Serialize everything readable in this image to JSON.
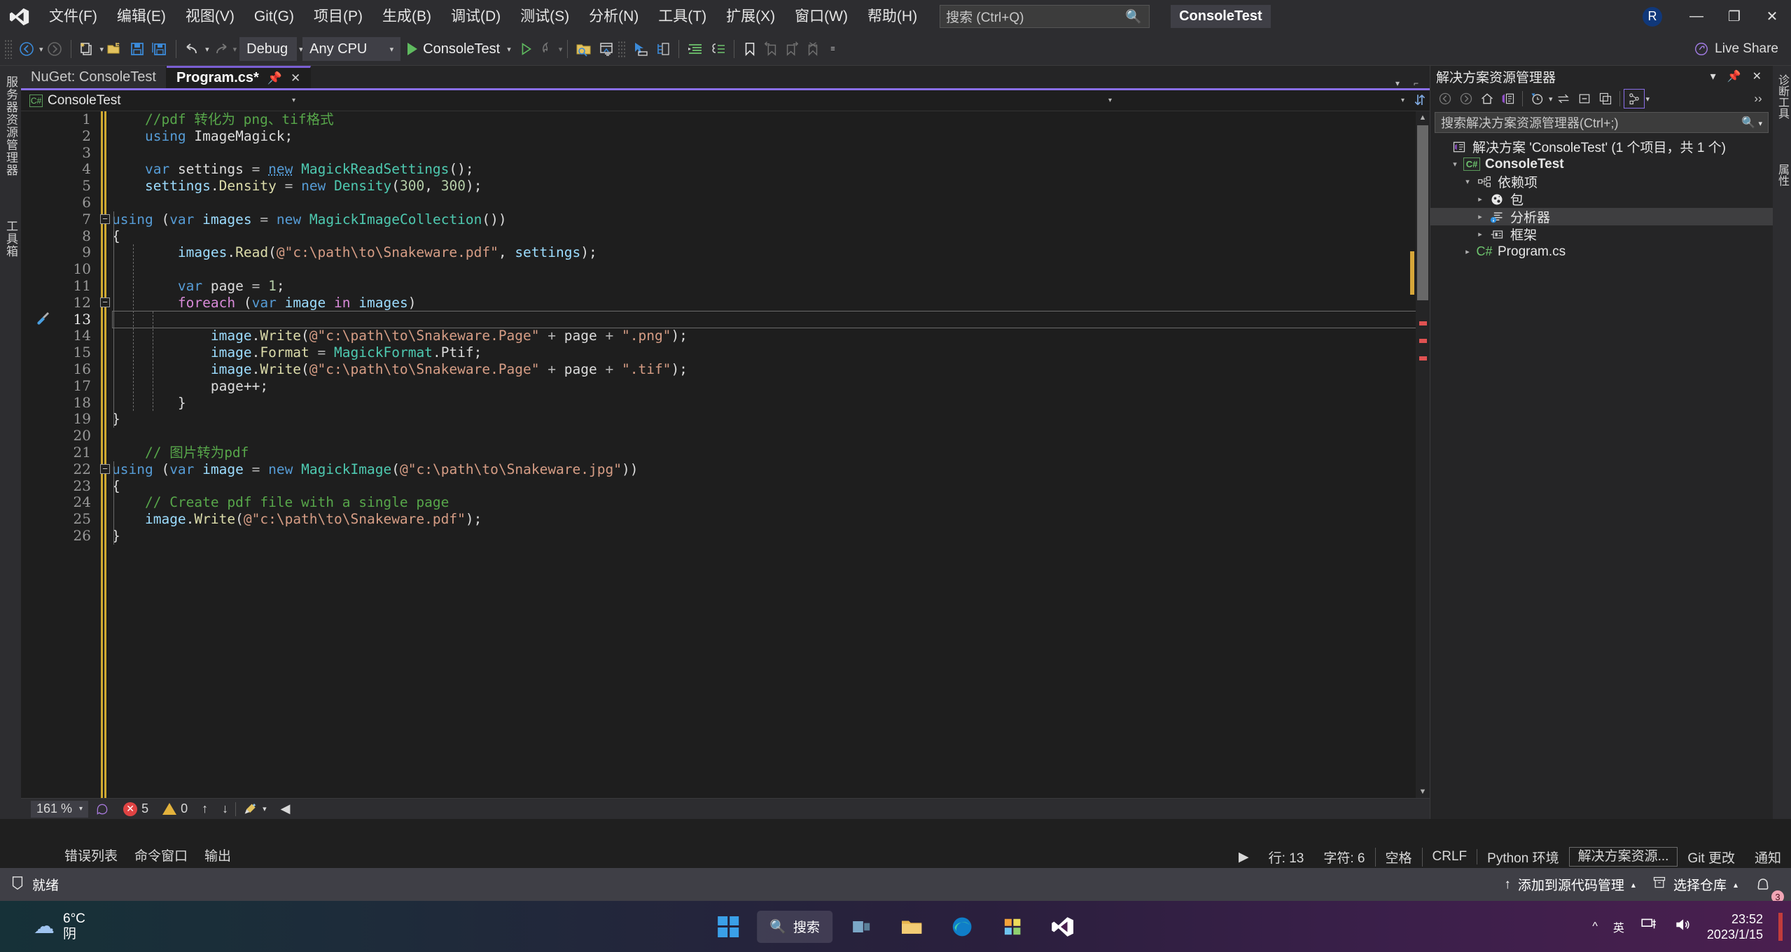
{
  "titlebar": {
    "menus": [
      "文件(F)",
      "编辑(E)",
      "视图(V)",
      "Git(G)",
      "项目(P)",
      "生成(B)",
      "调试(D)",
      "测试(S)",
      "分析(N)",
      "工具(T)",
      "扩展(X)",
      "窗口(W)",
      "帮助(H)"
    ],
    "search_placeholder": "搜索 (Ctrl+Q)",
    "project_chip": "ConsoleTest",
    "avatar_initial": "R",
    "minimize": "—",
    "restore": "❐",
    "close": "✕"
  },
  "toolbar": {
    "config": "Debug",
    "platform": "Any CPU",
    "run_target": "ConsoleTest",
    "live_share": "Live Share"
  },
  "rail": {
    "server_explorer": "服务器资源管理器",
    "toolbox": "工具箱"
  },
  "editor": {
    "tabs": [
      {
        "label": "NuGet: ConsoleTest",
        "active": false,
        "modified": false
      },
      {
        "label": "Program.cs*",
        "active": true,
        "modified": true
      }
    ],
    "breadcrumb_project": "ConsoleTest",
    "breadcrumb_type": "",
    "breadcrumb_member": "",
    "line_count_start": 1,
    "lines": [
      {
        "n": 1,
        "tokens": [
          {
            "t": "//pdf 转化为 png、tif格式",
            "c": "c"
          }
        ],
        "indent": 1
      },
      {
        "n": 2,
        "tokens": [
          {
            "t": "using",
            "c": "k"
          },
          {
            "t": " ImageMagick;",
            "c": "p"
          }
        ],
        "indent": 1
      },
      {
        "n": 3,
        "tokens": [],
        "indent": 1
      },
      {
        "n": 4,
        "tokens": [
          {
            "t": "var",
            "c": "k"
          },
          {
            "t": " settings ",
            "c": "p"
          },
          {
            "t": "=",
            "c": "op"
          },
          {
            "t": " ",
            "c": "p"
          },
          {
            "t": "new",
            "c": "k sq"
          },
          {
            "t": " ",
            "c": "p"
          },
          {
            "t": "MagickReadSettings",
            "c": "t"
          },
          {
            "t": "();",
            "c": "p"
          }
        ],
        "indent": 1
      },
      {
        "n": 5,
        "tokens": [
          {
            "t": "settings",
            "c": "id"
          },
          {
            "t": ".",
            "c": "p"
          },
          {
            "t": "Density",
            "c": "m"
          },
          {
            "t": " ",
            "c": "p"
          },
          {
            "t": "=",
            "c": "op"
          },
          {
            "t": " ",
            "c": "p"
          },
          {
            "t": "new",
            "c": "k"
          },
          {
            "t": " ",
            "c": "p"
          },
          {
            "t": "Density",
            "c": "t"
          },
          {
            "t": "(",
            "c": "p"
          },
          {
            "t": "300",
            "c": "n"
          },
          {
            "t": ", ",
            "c": "p"
          },
          {
            "t": "300",
            "c": "n"
          },
          {
            "t": ");",
            "c": "p"
          }
        ],
        "indent": 1
      },
      {
        "n": 6,
        "tokens": [],
        "indent": 1
      },
      {
        "n": 7,
        "tokens": [
          {
            "t": "using",
            "c": "k"
          },
          {
            "t": " (",
            "c": "p"
          },
          {
            "t": "var",
            "c": "k"
          },
          {
            "t": " ",
            "c": "p"
          },
          {
            "t": "images",
            "c": "id"
          },
          {
            "t": " ",
            "c": "p"
          },
          {
            "t": "=",
            "c": "op"
          },
          {
            "t": " ",
            "c": "p"
          },
          {
            "t": "new",
            "c": "k"
          },
          {
            "t": " ",
            "c": "p"
          },
          {
            "t": "MagickImageCollection",
            "c": "t"
          },
          {
            "t": "())",
            "c": "p"
          }
        ],
        "indent": 0,
        "fold": "minus"
      },
      {
        "n": 8,
        "tokens": [
          {
            "t": "{",
            "c": "p"
          }
        ],
        "indent": 0
      },
      {
        "n": 9,
        "tokens": [
          {
            "t": "images",
            "c": "id"
          },
          {
            "t": ".",
            "c": "p"
          },
          {
            "t": "Read",
            "c": "m"
          },
          {
            "t": "(",
            "c": "p"
          },
          {
            "t": "@\"c:\\path\\to\\Snakeware.pdf\"",
            "c": "s"
          },
          {
            "t": ", ",
            "c": "p"
          },
          {
            "t": "settings",
            "c": "id"
          },
          {
            "t": ");",
            "c": "p"
          }
        ],
        "indent": 2
      },
      {
        "n": 10,
        "tokens": [],
        "indent": 2
      },
      {
        "n": 11,
        "tokens": [
          {
            "t": "var",
            "c": "k"
          },
          {
            "t": " page ",
            "c": "p"
          },
          {
            "t": "=",
            "c": "op"
          },
          {
            "t": " ",
            "c": "p"
          },
          {
            "t": "1",
            "c": "n"
          },
          {
            "t": ";",
            "c": "p"
          }
        ],
        "indent": 2
      },
      {
        "n": 12,
        "tokens": [
          {
            "t": "foreach",
            "c": "kc"
          },
          {
            "t": " (",
            "c": "p"
          },
          {
            "t": "var",
            "c": "k"
          },
          {
            "t": " ",
            "c": "p"
          },
          {
            "t": "image",
            "c": "id"
          },
          {
            "t": " ",
            "c": "p"
          },
          {
            "t": "in",
            "c": "kc"
          },
          {
            "t": " ",
            "c": "p"
          },
          {
            "t": "images",
            "c": "id"
          },
          {
            "t": ")",
            "c": "p"
          }
        ],
        "indent": 2,
        "fold": "minus"
      },
      {
        "n": 13,
        "tokens": [
          {
            "t": "{",
            "c": "p"
          }
        ],
        "indent": 2,
        "current": true,
        "lightbulb": "screwdriver"
      },
      {
        "n": 14,
        "tokens": [
          {
            "t": "image",
            "c": "id"
          },
          {
            "t": ".",
            "c": "p"
          },
          {
            "t": "Write",
            "c": "m"
          },
          {
            "t": "(",
            "c": "p"
          },
          {
            "t": "@\"c:\\path\\to\\Snakeware.Page\"",
            "c": "s"
          },
          {
            "t": " ",
            "c": "p"
          },
          {
            "t": "+",
            "c": "op"
          },
          {
            "t": " page ",
            "c": "p"
          },
          {
            "t": "+",
            "c": "op"
          },
          {
            "t": " ",
            "c": "p"
          },
          {
            "t": "\".png\"",
            "c": "s"
          },
          {
            "t": ");",
            "c": "p"
          }
        ],
        "indent": 3
      },
      {
        "n": 15,
        "tokens": [
          {
            "t": "image",
            "c": "id"
          },
          {
            "t": ".",
            "c": "p"
          },
          {
            "t": "Format",
            "c": "m"
          },
          {
            "t": " ",
            "c": "p"
          },
          {
            "t": "=",
            "c": "op"
          },
          {
            "t": " ",
            "c": "p"
          },
          {
            "t": "MagickFormat",
            "c": "t"
          },
          {
            "t": ".",
            "c": "p"
          },
          {
            "t": "Ptif",
            "c": "p"
          },
          {
            "t": ";",
            "c": "p"
          }
        ],
        "indent": 3
      },
      {
        "n": 16,
        "tokens": [
          {
            "t": "image",
            "c": "id"
          },
          {
            "t": ".",
            "c": "p"
          },
          {
            "t": "Write",
            "c": "m"
          },
          {
            "t": "(",
            "c": "p"
          },
          {
            "t": "@\"c:\\path\\to\\Snakeware.Page\"",
            "c": "s"
          },
          {
            "t": " ",
            "c": "p"
          },
          {
            "t": "+",
            "c": "op"
          },
          {
            "t": " page ",
            "c": "p"
          },
          {
            "t": "+",
            "c": "op"
          },
          {
            "t": " ",
            "c": "p"
          },
          {
            "t": "\".tif\"",
            "c": "s"
          },
          {
            "t": ");",
            "c": "p"
          }
        ],
        "indent": 3
      },
      {
        "n": 17,
        "tokens": [
          {
            "t": "page",
            "c": "p"
          },
          {
            "t": "++;",
            "c": "p"
          }
        ],
        "indent": 3
      },
      {
        "n": 18,
        "tokens": [
          {
            "t": "}",
            "c": "p"
          }
        ],
        "indent": 2
      },
      {
        "n": 19,
        "tokens": [
          {
            "t": "}",
            "c": "p"
          }
        ],
        "indent": 0
      },
      {
        "n": 20,
        "tokens": [],
        "indent": 1
      },
      {
        "n": 21,
        "tokens": [
          {
            "t": "// 图片转为pdf",
            "c": "c"
          }
        ],
        "indent": 1
      },
      {
        "n": 22,
        "tokens": [
          {
            "t": "using",
            "c": "k"
          },
          {
            "t": " (",
            "c": "p"
          },
          {
            "t": "var",
            "c": "k"
          },
          {
            "t": " ",
            "c": "p"
          },
          {
            "t": "image",
            "c": "id"
          },
          {
            "t": " ",
            "c": "p"
          },
          {
            "t": "=",
            "c": "op"
          },
          {
            "t": " ",
            "c": "p"
          },
          {
            "t": "new",
            "c": "k"
          },
          {
            "t": " ",
            "c": "p"
          },
          {
            "t": "MagickImage",
            "c": "t"
          },
          {
            "t": "(",
            "c": "p"
          },
          {
            "t": "@\"c:\\path\\to\\Snakeware.jpg\"",
            "c": "s"
          },
          {
            "t": "))",
            "c": "p"
          }
        ],
        "indent": 0,
        "fold": "minus"
      },
      {
        "n": 23,
        "tokens": [
          {
            "t": "{",
            "c": "p"
          }
        ],
        "indent": 0
      },
      {
        "n": 24,
        "tokens": [
          {
            "t": "// Create pdf file with a single page",
            "c": "c"
          }
        ],
        "indent": 1
      },
      {
        "n": 25,
        "tokens": [
          {
            "t": "image",
            "c": "id"
          },
          {
            "t": ".",
            "c": "p"
          },
          {
            "t": "Write",
            "c": "m"
          },
          {
            "t": "(",
            "c": "p"
          },
          {
            "t": "@\"c:\\path\\to\\Snakeware.pdf\"",
            "c": "s"
          },
          {
            "t": ");",
            "c": "p"
          }
        ],
        "indent": 1
      },
      {
        "n": 26,
        "tokens": [
          {
            "t": "}",
            "c": "p"
          }
        ],
        "indent": 0
      }
    ]
  },
  "editor_status": {
    "zoom": "161 %",
    "errors_count": "5",
    "warnings_count": "0",
    "up_arrow": "↑",
    "down_arrow": "↓"
  },
  "solution_explorer": {
    "title": "解决方案资源管理器",
    "search_placeholder": "搜索解决方案资源管理器(Ctrl+;)",
    "tree": [
      {
        "label": "解决方案 'ConsoleTest' (1 个项目，共 1 个)",
        "depth": 0,
        "icon": "solution-icon",
        "twisty": "",
        "bold": false,
        "selected": false
      },
      {
        "label": "ConsoleTest",
        "depth": 1,
        "icon": "csharp-project-icon",
        "twisty": "▾",
        "bold": true,
        "selected": false
      },
      {
        "label": "依赖项",
        "depth": 2,
        "icon": "dependencies-icon",
        "twisty": "▾",
        "bold": false,
        "selected": false
      },
      {
        "label": "包",
        "depth": 3,
        "icon": "package-icon",
        "twisty": "▸",
        "bold": false,
        "selected": false
      },
      {
        "label": "分析器",
        "depth": 3,
        "icon": "analyzer-icon",
        "twisty": "▸",
        "bold": false,
        "selected": true
      },
      {
        "label": "框架",
        "depth": 3,
        "icon": "framework-icon",
        "twisty": "▸",
        "bold": false,
        "selected": false
      },
      {
        "label": "Program.cs",
        "depth": 2,
        "icon": "csharp-file-icon",
        "twisty": "▸",
        "bold": false,
        "selected": false
      }
    ],
    "far_rail": [
      "诊断工具",
      "属性"
    ]
  },
  "dock_tabs": [
    "错误列表",
    "命令窗口",
    "输出"
  ],
  "statusbar": {
    "ready": "就绪",
    "line_label": "行: 13",
    "char_label": "字符: 6",
    "spaces": "空格",
    "eol": "CRLF",
    "python_env": "Python 环境",
    "solution_explorer": "解决方案资源...",
    "git_changes": "Git 更改",
    "notifications": "通知",
    "add_to_source": "添加到源代码管理",
    "select_repo": "选择仓库",
    "notif_badge": "3"
  },
  "taskbar": {
    "temperature": "6°C",
    "condition": "阴",
    "search_label": "搜索",
    "ime": "英",
    "time": "23:52",
    "date": "2023/1/15"
  }
}
